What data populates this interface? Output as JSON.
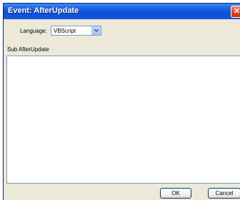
{
  "window": {
    "title": "Event: AfterUpdate",
    "close_glyph": "✕"
  },
  "language": {
    "label": "Language:",
    "selected": "VBScript",
    "options": [
      "VBScript"
    ]
  },
  "code": {
    "header_label": "Sub AfterUpdate",
    "value": ""
  },
  "buttons": {
    "ok": "OK",
    "cancel": "Cancel"
  },
  "colors": {
    "titlebar": "#0f4fd6",
    "dialog_bg": "#ece9d8",
    "close_button": "#d9411f"
  },
  "icons": {
    "close": "close-icon",
    "dropdown": "chevron-down-icon"
  }
}
